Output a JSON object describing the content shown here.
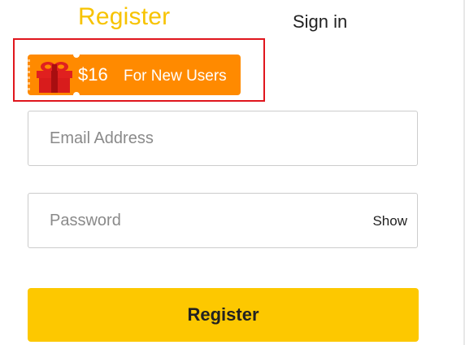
{
  "tabs": {
    "register_label": "Register",
    "signin_label": "Sign in",
    "active": "register",
    "active_color": "#f7c300"
  },
  "promo": {
    "amount": "$16",
    "text": "For New Users",
    "icon": "gift-icon",
    "ticket_color": "#ff8a00",
    "highlight_color": "#e0161d"
  },
  "form": {
    "email": {
      "placeholder": "Email Address",
      "value": ""
    },
    "password": {
      "placeholder": "Password",
      "value": "",
      "show_label": "Show"
    },
    "submit_label": "Register",
    "submit_color": "#fdc800"
  }
}
